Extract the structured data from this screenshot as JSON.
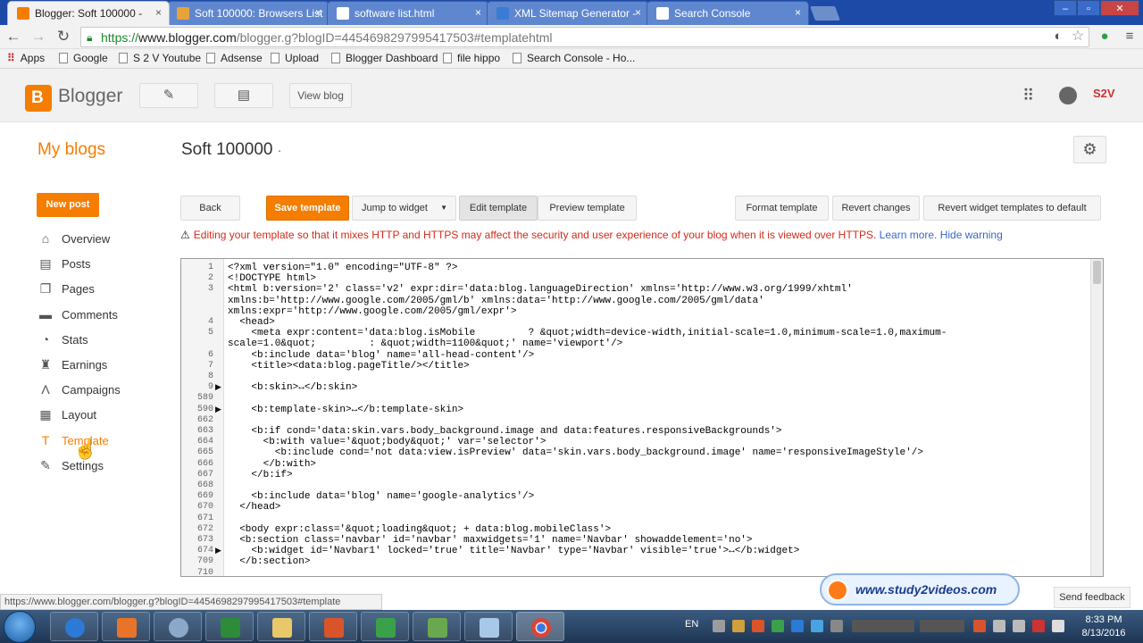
{
  "browser": {
    "tabs": [
      {
        "title": "Blogger: Soft 100000 -",
        "active": true,
        "icon_color": "#f57d00"
      },
      {
        "title": "Soft 100000: Browsers List",
        "active": false,
        "icon_color": "#e8a23a"
      },
      {
        "title": "software list.html",
        "active": false,
        "icon_color": "#ffffff"
      },
      {
        "title": "XML Sitemap Generator -",
        "active": false,
        "icon_color": "#3a7bd5"
      },
      {
        "title": "Search Console",
        "active": false,
        "icon_color": "#ffffff"
      }
    ],
    "tab_close_glyph": "×",
    "url_https": "https://",
    "url_host": "www.blogger.com",
    "url_path": "/blogger.g?blogID=4454698297995417503#templatehtml",
    "bookmarks": [
      "Apps",
      "Google",
      "S 2 V Youtube",
      "Adsense",
      "Upload",
      "Blogger Dashboard",
      "file hippo",
      "Search Console - Ho..."
    ]
  },
  "blogger": {
    "brand": "Blogger",
    "view_blog": "View blog",
    "avatar_text": "S2V",
    "my_blogs": "My blogs",
    "blog_title": "Soft 100000",
    "blog_title_dot": "·",
    "new_post": "New post",
    "nav": [
      {
        "label": "Overview",
        "icon": "home-icon",
        "glyph": "⌂"
      },
      {
        "label": "Posts",
        "icon": "posts-icon",
        "glyph": "▤"
      },
      {
        "label": "Pages",
        "icon": "pages-icon",
        "glyph": "❐"
      },
      {
        "label": "Comments",
        "icon": "comments-icon",
        "glyph": "▬"
      },
      {
        "label": "Stats",
        "icon": "stats-icon",
        "glyph": "◔"
      },
      {
        "label": "Earnings",
        "icon": "trophy-icon",
        "glyph": "♜"
      },
      {
        "label": "Campaigns",
        "icon": "campaigns-icon",
        "glyph": "Ʌ"
      },
      {
        "label": "Layout",
        "icon": "layout-icon",
        "glyph": "▦"
      },
      {
        "label": "Template",
        "icon": "template-icon",
        "glyph": "T",
        "active": true
      },
      {
        "label": "Settings",
        "icon": "wrench-icon",
        "glyph": "✎"
      }
    ],
    "buttons": {
      "back": "Back",
      "save_template": "Save template",
      "jump_to_widget": "Jump to widget",
      "edit_template": "Edit template",
      "preview_template": "Preview template",
      "format_template": "Format template",
      "revert_changes": "Revert changes",
      "revert_widgets": "Revert widget templates to default"
    },
    "warning": {
      "text": "Editing your template so that it mixes HTTP and HTTPS may affect the security and user experience of your blog when it is viewed over HTTPS.",
      "learn_more": "Learn more.",
      "hide": "Hide warning"
    },
    "editor": {
      "lines": [
        {
          "n": "1",
          "code": "<?xml version=\"1.0\" encoding=\"UTF-8\" ?>"
        },
        {
          "n": "2",
          "code": "<!DOCTYPE html>"
        },
        {
          "n": "3",
          "code": "<html b:version='2' class='v2' expr:dir='data:blog.languageDirection' xmlns='http://www.w3.org/1999/xhtml'"
        },
        {
          "n": "",
          "code": "xmlns:b='http://www.google.com/2005/gml/b' xmlns:data='http://www.google.com/2005/gml/data'"
        },
        {
          "n": "",
          "code": "xmlns:expr='http://www.google.com/2005/gml/expr'>"
        },
        {
          "n": "4",
          "code": "  <head>"
        },
        {
          "n": "5",
          "code": "    <meta expr:content='data:blog.isMobile         ? &quot;width=device-width,initial-scale=1.0,minimum-scale=1.0,maximum-"
        },
        {
          "n": "",
          "code": "scale=1.0&quot;         : &quot;width=1100&quot;' name='viewport'/>"
        },
        {
          "n": "6",
          "code": "    <b:include data='blog' name='all-head-content'/>"
        },
        {
          "n": "7",
          "code": "    <title><data:blog.pageTitle/></title>"
        },
        {
          "n": "8",
          "code": ""
        },
        {
          "n": "9",
          "code": "    <b:skin>↔</b:skin>",
          "fold": true
        },
        {
          "n": "589",
          "code": ""
        },
        {
          "n": "590",
          "code": "    <b:template-skin>↔</b:template-skin>",
          "fold": true
        },
        {
          "n": "662",
          "code": ""
        },
        {
          "n": "663",
          "code": "    <b:if cond='data:skin.vars.body_background.image and data:features.responsiveBackgrounds'>"
        },
        {
          "n": "664",
          "code": "      <b:with value='&quot;body&quot;' var='selector'>"
        },
        {
          "n": "665",
          "code": "        <b:include cond='not data:view.isPreview' data='skin.vars.body_background.image' name='responsiveImageStyle'/>"
        },
        {
          "n": "666",
          "code": "      </b:with>"
        },
        {
          "n": "667",
          "code": "    </b:if>"
        },
        {
          "n": "668",
          "code": ""
        },
        {
          "n": "669",
          "code": "    <b:include data='blog' name='google-analytics'/>"
        },
        {
          "n": "670",
          "code": "  </head>"
        },
        {
          "n": "671",
          "code": ""
        },
        {
          "n": "672",
          "code": "  <body expr:class='&quot;loading&quot; + data:blog.mobileClass'>"
        },
        {
          "n": "673",
          "code": "  <b:section class='navbar' id='navbar' maxwidgets='1' name='Navbar' showaddelement='no'>"
        },
        {
          "n": "674",
          "code": "    <b:widget id='Navbar1' locked='true' title='Navbar' type='Navbar' visible='true'>↔</b:widget>",
          "fold": true
        },
        {
          "n": "709",
          "code": "  </b:section>"
        },
        {
          "n": "710",
          "code": ""
        }
      ]
    },
    "send_feedback": "Send feedback"
  },
  "status_url": "https://www.blogger.com/blogger.g?blogID=4454698297995417503#template",
  "watermark": "www.study2videos.com",
  "taskbar": {
    "language": "EN",
    "time": "8:33 PM",
    "date": "8/13/2016"
  },
  "colors": {
    "accent": "#f57d00",
    "warning": "#d42a1a",
    "link": "#3b67c8"
  }
}
